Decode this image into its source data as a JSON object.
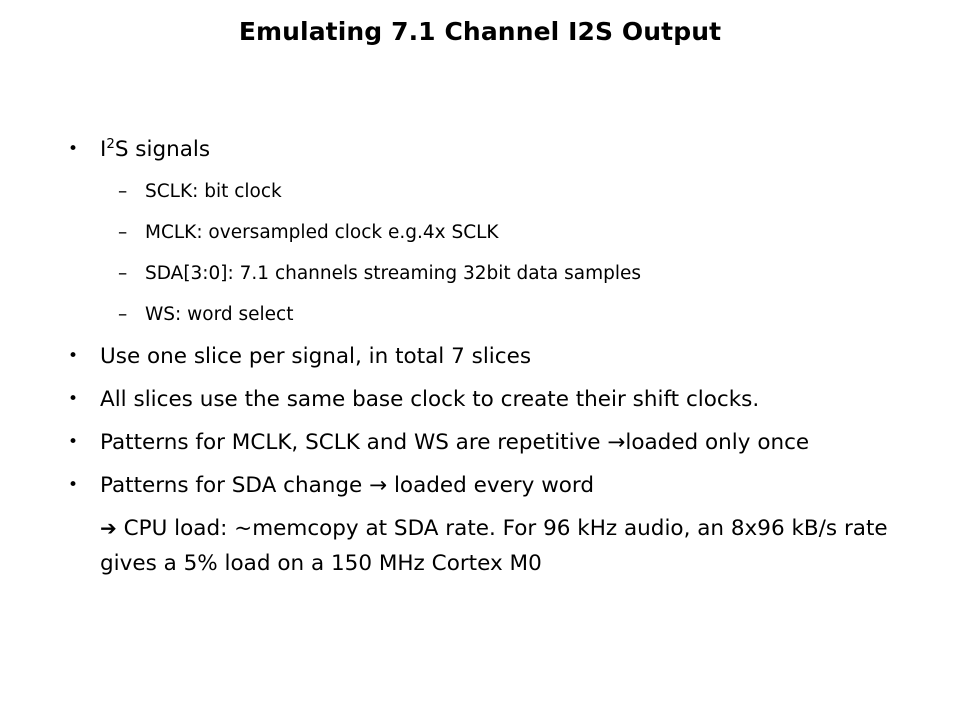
{
  "slide": {
    "title": "Emulating 7.1 Channel I2S Output",
    "background_color": "#ffffff",
    "text_color": "#000000",
    "bullets": [
      {
        "level": 1,
        "marker": "•",
        "text_before_sup": "I",
        "sup": "2",
        "text_after_sup": "S signals"
      },
      {
        "level": 2,
        "marker": "–",
        "text": "SCLK: bit clock"
      },
      {
        "level": 2,
        "marker": "–",
        "text": "MCLK: oversampled clock e.g.4x SCLK"
      },
      {
        "level": 2,
        "marker": "–",
        "text": "SDA[3:0]: 7.1 channels streaming 32bit data samples"
      },
      {
        "level": 2,
        "marker": "–",
        "text": "WS: word select"
      },
      {
        "level": 1,
        "marker": "•",
        "text": "Use one slice per signal, in total 7 slices"
      },
      {
        "level": 1,
        "marker": "•",
        "text": "All slices use the same base clock to create their shift clocks."
      },
      {
        "level": 1,
        "marker": "•",
        "text": "Patterns for MCLK, SCLK and WS are repetitive →loaded only once"
      },
      {
        "level": 1,
        "marker": "•",
        "text": "Patterns for SDA change → loaded every word"
      }
    ],
    "closing_paragraph": {
      "arrow": "➔",
      "text": "CPU load: ~memcopy at SDA rate. For 96 kHz audio, an 8x96 kB/s rate gives a 5% load on a 150 MHz Cortex M0"
    }
  }
}
